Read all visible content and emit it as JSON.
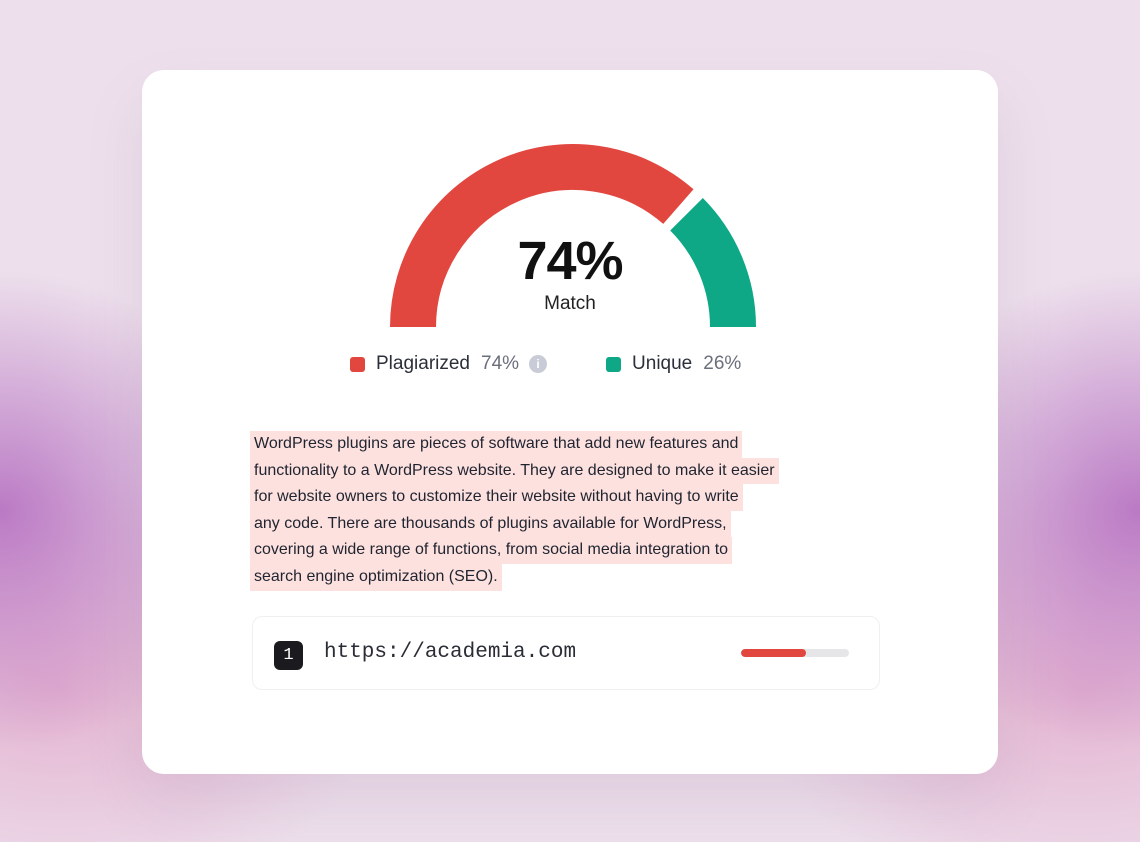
{
  "gauge": {
    "value_label": "74%",
    "caption": "Match",
    "plagiarized_fraction": 0.74,
    "unique_fraction": 0.26
  },
  "legend": {
    "plagiarized": {
      "label": "Plagiarized",
      "percent": "74%",
      "color": "#e2473f",
      "icon": "info-icon"
    },
    "unique": {
      "label": "Unique",
      "percent": "26%",
      "color": "#0ea886"
    }
  },
  "text": {
    "lines": [
      "WordPress plugins are pieces of software that add new features and",
      "functionality to a WordPress website. They are designed to make it easier",
      "for website owners to customize their website without having to write",
      "any code. There are thousands of plugins available for WordPress,",
      "covering a wide range of functions, from social media integration to",
      "search engine optimization (SEO)."
    ],
    "highlight_color": "#fde1df"
  },
  "sources": [
    {
      "rank": "1",
      "url": "https://academia.com",
      "match_fraction": 0.6,
      "bar_color": "#e2473f"
    }
  ]
}
